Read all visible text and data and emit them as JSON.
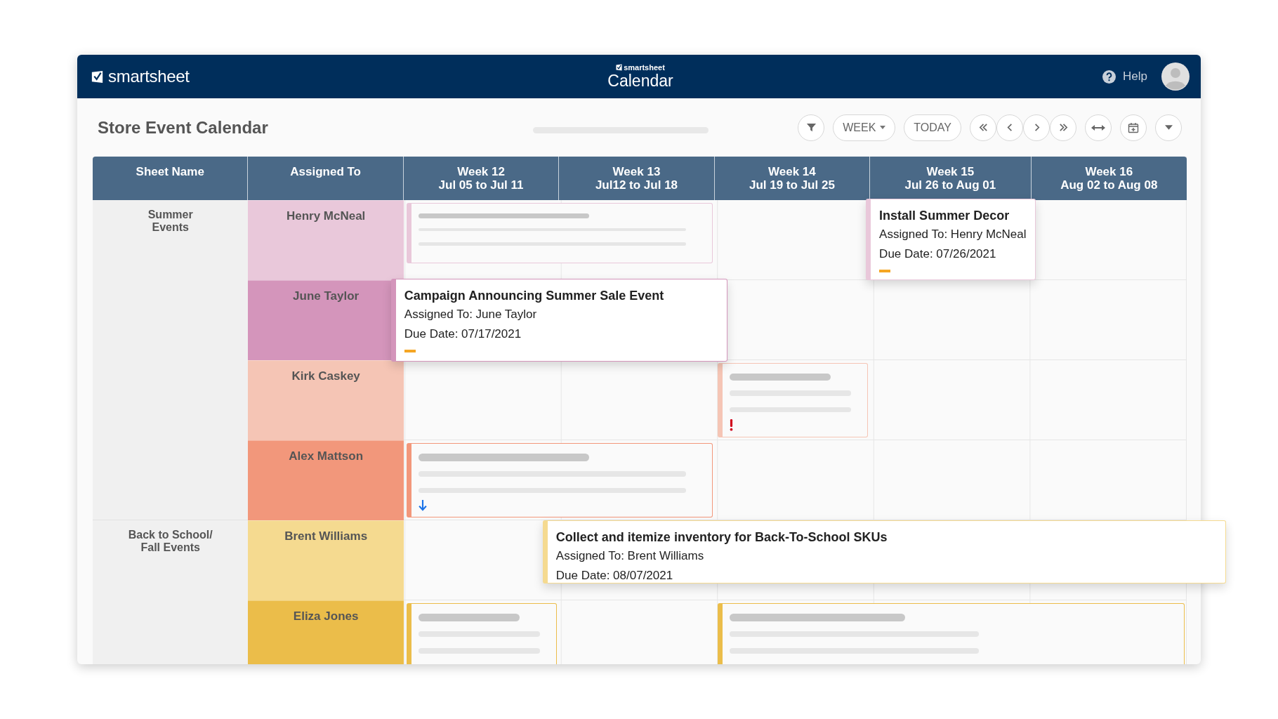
{
  "app": {
    "brand": "smartsheet",
    "sub_brand": "smartsheet",
    "title": "Calendar",
    "help": "Help"
  },
  "page": {
    "title": "Store Event Calendar"
  },
  "toolbar": {
    "view": "WEEK",
    "today": "TODAY"
  },
  "columns": [
    "Sheet Name",
    "Assigned To"
  ],
  "weeks": [
    {
      "name": "Week 12",
      "range": "Jul 05 to Jul 11"
    },
    {
      "name": "Week 13",
      "range": "Jul12 to Jul 18"
    },
    {
      "name": "Week 14",
      "range": "Jul 19 to Jul 25"
    },
    {
      "name": "Week 15",
      "range": "Jul 26 to Aug 01"
    },
    {
      "name": "Week 16",
      "range": "Aug 02 to Aug 08"
    }
  ],
  "groups": [
    {
      "sheet": "Summer\nEvents",
      "people": [
        {
          "name": "Henry McNeal",
          "color": "#e9c8da",
          "events": [
            {
              "kind": "placeholder"
            },
            {
              "kind": "detail",
              "title": "Install Summer Decor",
              "assigned": "Assigned To: Henry McNeal",
              "due": "Due Date: 07/26/2021",
              "dash_mark": true
            }
          ]
        },
        {
          "name": "June Taylor",
          "color": "#d495bb",
          "events": [
            {
              "kind": "detail",
              "title": "Campaign Announcing Summer Sale Event",
              "assigned": "Assigned To: June Taylor",
              "due": "Due Date: 07/17/2021",
              "dash_mark": true
            }
          ]
        },
        {
          "name": "Kirk Caskey",
          "color": "#f5c5b5",
          "events": [
            {
              "kind": "placeholder",
              "alert_mark": true
            }
          ]
        },
        {
          "name": "Alex Mattson",
          "color": "#f2977b",
          "events": [
            {
              "kind": "placeholder",
              "down_arrow": true
            }
          ]
        }
      ]
    },
    {
      "sheet": "Back to School/\nFall Events",
      "people": [
        {
          "name": "Brent Williams",
          "color": "#f5da90",
          "events": [
            {
              "kind": "detail",
              "title": "Collect and itemize inventory for Back-To-School SKUs",
              "assigned": "Assigned To: Brent Williams",
              "due": "Due Date: 08/07/2021"
            }
          ]
        },
        {
          "name": "Eliza Jones",
          "color": "#ebbd4a",
          "events": [
            {
              "kind": "placeholder"
            },
            {
              "kind": "placeholder"
            }
          ]
        }
      ]
    }
  ]
}
